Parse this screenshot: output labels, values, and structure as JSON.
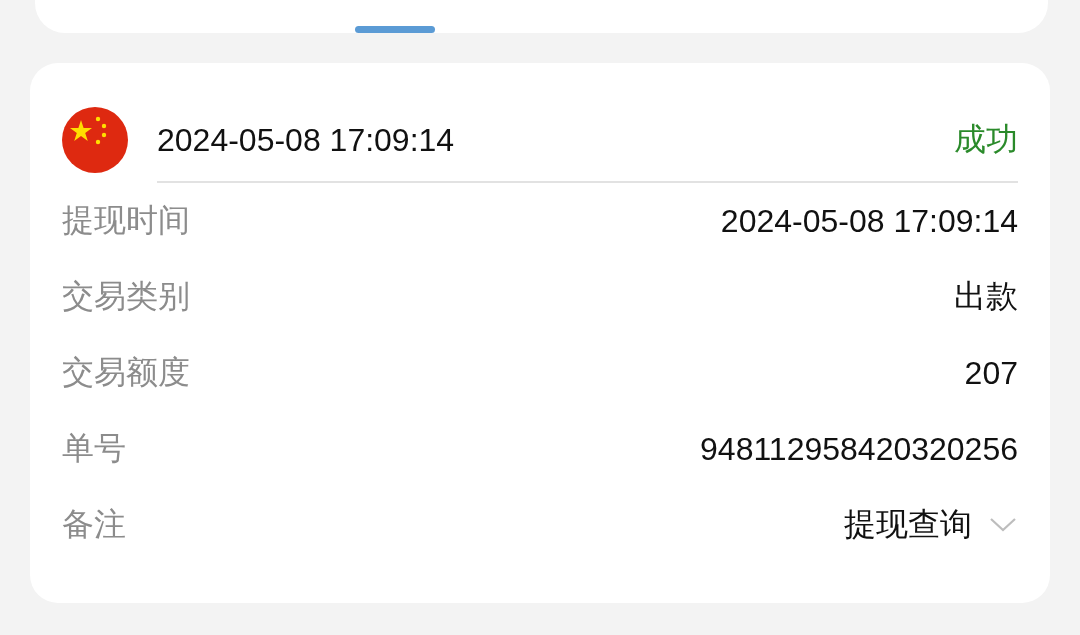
{
  "header": {
    "date": "2024-05-08 17:09:14",
    "status": "成功",
    "success": true
  },
  "rows": [
    {
      "label": "提现时间",
      "value": "2024-05-08 17:09:14",
      "kind": "text"
    },
    {
      "label": "交易类别",
      "value": "出款",
      "kind": "text"
    },
    {
      "label": "交易额度",
      "value": "207",
      "kind": "text"
    },
    {
      "label": "单号",
      "value": "948112958420320256",
      "kind": "text"
    },
    {
      "label": "备注",
      "value": "提现查询",
      "kind": "dropdown"
    }
  ]
}
